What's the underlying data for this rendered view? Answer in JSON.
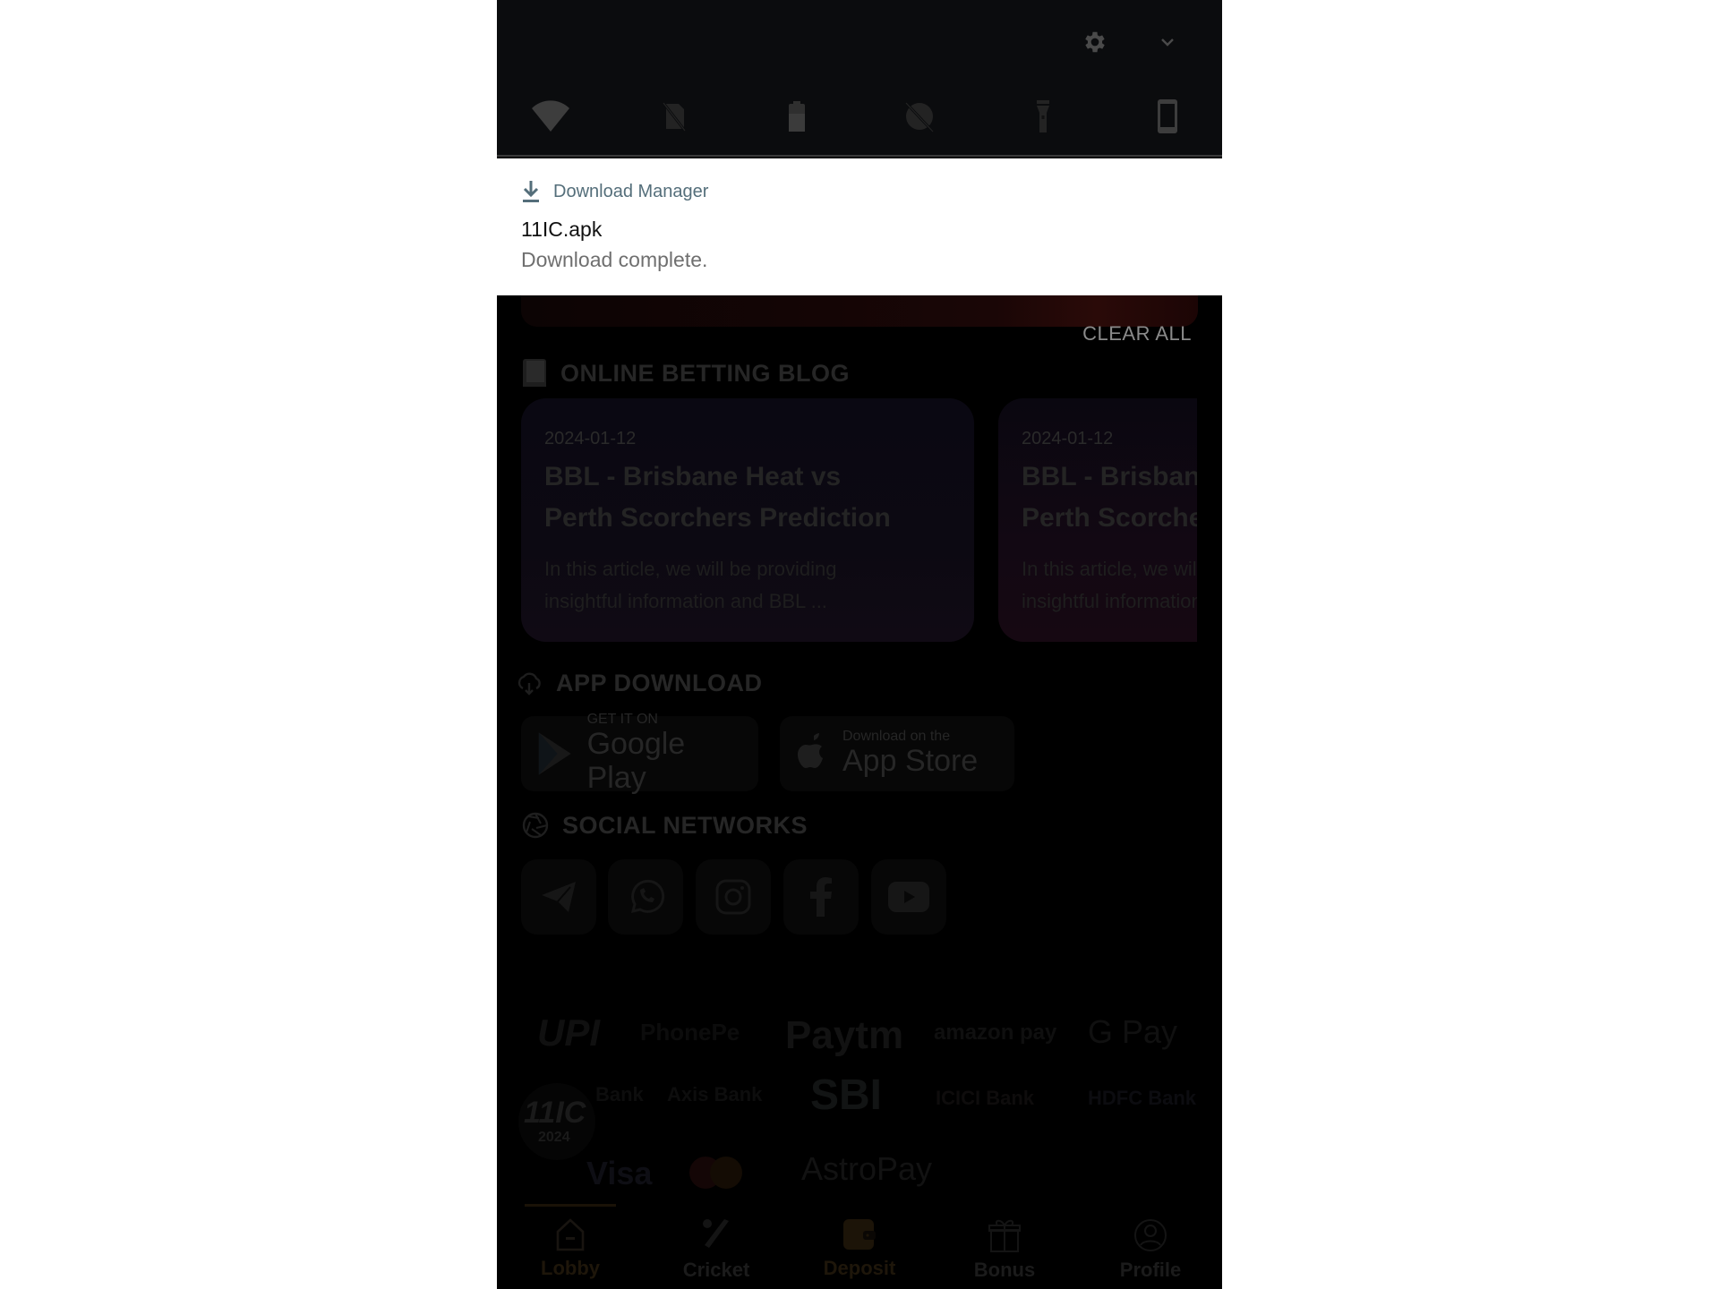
{
  "quick_settings": {
    "top_icons": [
      "gear-icon",
      "chevron-down-icon"
    ],
    "tiles": [
      {
        "name": "wifi",
        "icon": "wifi-icon"
      },
      {
        "name": "mobile-data-off",
        "icon": "no-sim-icon"
      },
      {
        "name": "battery-saver",
        "icon": "battery-icon"
      },
      {
        "name": "do-not-disturb-off",
        "icon": "dnd-off-icon"
      },
      {
        "name": "flashlight",
        "icon": "flashlight-icon"
      },
      {
        "name": "auto-rotate",
        "icon": "phone-rotate-icon"
      }
    ]
  },
  "notification": {
    "app_name": "Download Manager",
    "title": "11IC.apk",
    "text": "Download complete."
  },
  "clear_all_label": "CLEAR ALL",
  "blog": {
    "heading": "ONLINE BETTING BLOG",
    "cards": [
      {
        "date": "2024-01-12",
        "title_line1": "BBL - Brisbane Heat vs",
        "title_line2": "Perth Scorchers Prediction",
        "text_line1": "In this article, we will be providing",
        "text_line2": "insightful information and BBL ..."
      },
      {
        "date": "2024-01-12",
        "title_line1": "BBL - Brisbane Heat vs",
        "title_line2": "Perth Scorchers Prediction",
        "text_line1": "In this article, we will be providing",
        "text_line2": "insightful information and BBL ..."
      }
    ]
  },
  "app_download": {
    "heading": "APP DOWNLOAD",
    "google_play": {
      "small": "GET IT ON",
      "big": "Google Play"
    },
    "app_store": {
      "small": "Download on the",
      "big": "App Store"
    }
  },
  "social": {
    "heading": "SOCIAL NETWORKS",
    "items": [
      "telegram",
      "whatsapp",
      "instagram",
      "facebook",
      "youtube"
    ]
  },
  "payments": {
    "row1": [
      "UPI",
      "PhonePe",
      "Paytm",
      "amazon pay",
      "G Pay"
    ],
    "row2": [
      "Bank",
      "Axis Bank",
      "SBI",
      "ICICI Bank",
      "HDFC Bank"
    ],
    "row3": [
      "Visa",
      "Mastercard",
      "AstroPay"
    ]
  },
  "brand_badge": {
    "line1": "11IC",
    "line2": "2024"
  },
  "bottom_nav": {
    "active": "Lobby",
    "items": [
      {
        "label": "Lobby",
        "icon": "home-icon"
      },
      {
        "label": "Cricket",
        "icon": "cricket-bat-icon"
      },
      {
        "label": "Deposit",
        "icon": "wallet-icon"
      },
      {
        "label": "Bonus",
        "icon": "gift-icon"
      },
      {
        "label": "Profile",
        "icon": "profile-icon"
      }
    ]
  },
  "colors": {
    "qs_bg": "#0b0c0e",
    "qs_icon": "#3d3d3d",
    "notif_app": "#546e7a",
    "scrim_text": "#8a8a8a"
  }
}
